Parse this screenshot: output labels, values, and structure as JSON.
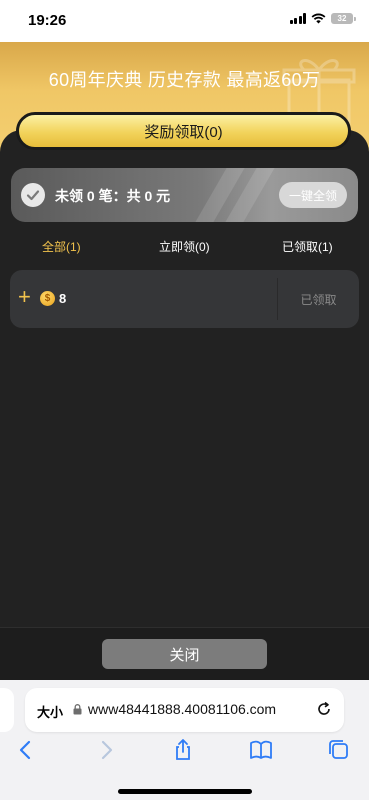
{
  "status_bar": {
    "time": "19:26",
    "battery": "32"
  },
  "banner": {
    "title": "60周年庆典 历史存款 最高返60万"
  },
  "claim_header": {
    "label": "奖励领取(0)"
  },
  "summary": {
    "text": "未领 0 笔：共 0 元",
    "claim_all_label": "一键全领"
  },
  "tabs": [
    {
      "label": "全部(1)",
      "active": true
    },
    {
      "label": "立即领(0)",
      "active": false
    },
    {
      "label": "已领取(1)",
      "active": false
    }
  ],
  "rewards": [
    {
      "amount": "8",
      "coin_symbol": "$",
      "status": "已领取"
    }
  ],
  "footer": {
    "close_label": "关闭"
  },
  "browser": {
    "text_size_label": "大小",
    "url": "www48441888.40081106.com"
  },
  "colors": {
    "accent": "#f2c34d",
    "panel": "#222222",
    "banner": "#f0c766"
  },
  "icons": [
    "check-icon",
    "plus-icon",
    "coin-icon",
    "lock-icon",
    "reload-icon",
    "back-icon",
    "forward-icon",
    "share-icon",
    "bookmarks-icon",
    "tabs-icon"
  ]
}
